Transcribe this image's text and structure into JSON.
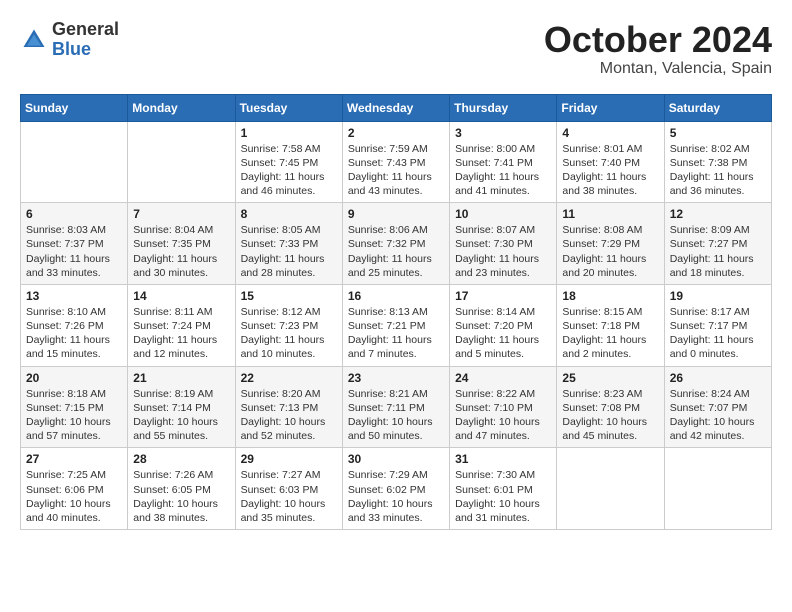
{
  "header": {
    "logo_general": "General",
    "logo_blue": "Blue",
    "month_title": "October 2024",
    "location": "Montan, Valencia, Spain"
  },
  "days_of_week": [
    "Sunday",
    "Monday",
    "Tuesday",
    "Wednesday",
    "Thursday",
    "Friday",
    "Saturday"
  ],
  "weeks": [
    [
      {
        "day": "",
        "info": ""
      },
      {
        "day": "",
        "info": ""
      },
      {
        "day": "1",
        "info": "Sunrise: 7:58 AM\nSunset: 7:45 PM\nDaylight: 11 hours and 46 minutes."
      },
      {
        "day": "2",
        "info": "Sunrise: 7:59 AM\nSunset: 7:43 PM\nDaylight: 11 hours and 43 minutes."
      },
      {
        "day": "3",
        "info": "Sunrise: 8:00 AM\nSunset: 7:41 PM\nDaylight: 11 hours and 41 minutes."
      },
      {
        "day": "4",
        "info": "Sunrise: 8:01 AM\nSunset: 7:40 PM\nDaylight: 11 hours and 38 minutes."
      },
      {
        "day": "5",
        "info": "Sunrise: 8:02 AM\nSunset: 7:38 PM\nDaylight: 11 hours and 36 minutes."
      }
    ],
    [
      {
        "day": "6",
        "info": "Sunrise: 8:03 AM\nSunset: 7:37 PM\nDaylight: 11 hours and 33 minutes."
      },
      {
        "day": "7",
        "info": "Sunrise: 8:04 AM\nSunset: 7:35 PM\nDaylight: 11 hours and 30 minutes."
      },
      {
        "day": "8",
        "info": "Sunrise: 8:05 AM\nSunset: 7:33 PM\nDaylight: 11 hours and 28 minutes."
      },
      {
        "day": "9",
        "info": "Sunrise: 8:06 AM\nSunset: 7:32 PM\nDaylight: 11 hours and 25 minutes."
      },
      {
        "day": "10",
        "info": "Sunrise: 8:07 AM\nSunset: 7:30 PM\nDaylight: 11 hours and 23 minutes."
      },
      {
        "day": "11",
        "info": "Sunrise: 8:08 AM\nSunset: 7:29 PM\nDaylight: 11 hours and 20 minutes."
      },
      {
        "day": "12",
        "info": "Sunrise: 8:09 AM\nSunset: 7:27 PM\nDaylight: 11 hours and 18 minutes."
      }
    ],
    [
      {
        "day": "13",
        "info": "Sunrise: 8:10 AM\nSunset: 7:26 PM\nDaylight: 11 hours and 15 minutes."
      },
      {
        "day": "14",
        "info": "Sunrise: 8:11 AM\nSunset: 7:24 PM\nDaylight: 11 hours and 12 minutes."
      },
      {
        "day": "15",
        "info": "Sunrise: 8:12 AM\nSunset: 7:23 PM\nDaylight: 11 hours and 10 minutes."
      },
      {
        "day": "16",
        "info": "Sunrise: 8:13 AM\nSunset: 7:21 PM\nDaylight: 11 hours and 7 minutes."
      },
      {
        "day": "17",
        "info": "Sunrise: 8:14 AM\nSunset: 7:20 PM\nDaylight: 11 hours and 5 minutes."
      },
      {
        "day": "18",
        "info": "Sunrise: 8:15 AM\nSunset: 7:18 PM\nDaylight: 11 hours and 2 minutes."
      },
      {
        "day": "19",
        "info": "Sunrise: 8:17 AM\nSunset: 7:17 PM\nDaylight: 11 hours and 0 minutes."
      }
    ],
    [
      {
        "day": "20",
        "info": "Sunrise: 8:18 AM\nSunset: 7:15 PM\nDaylight: 10 hours and 57 minutes."
      },
      {
        "day": "21",
        "info": "Sunrise: 8:19 AM\nSunset: 7:14 PM\nDaylight: 10 hours and 55 minutes."
      },
      {
        "day": "22",
        "info": "Sunrise: 8:20 AM\nSunset: 7:13 PM\nDaylight: 10 hours and 52 minutes."
      },
      {
        "day": "23",
        "info": "Sunrise: 8:21 AM\nSunset: 7:11 PM\nDaylight: 10 hours and 50 minutes."
      },
      {
        "day": "24",
        "info": "Sunrise: 8:22 AM\nSunset: 7:10 PM\nDaylight: 10 hours and 47 minutes."
      },
      {
        "day": "25",
        "info": "Sunrise: 8:23 AM\nSunset: 7:08 PM\nDaylight: 10 hours and 45 minutes."
      },
      {
        "day": "26",
        "info": "Sunrise: 8:24 AM\nSunset: 7:07 PM\nDaylight: 10 hours and 42 minutes."
      }
    ],
    [
      {
        "day": "27",
        "info": "Sunrise: 7:25 AM\nSunset: 6:06 PM\nDaylight: 10 hours and 40 minutes."
      },
      {
        "day": "28",
        "info": "Sunrise: 7:26 AM\nSunset: 6:05 PM\nDaylight: 10 hours and 38 minutes."
      },
      {
        "day": "29",
        "info": "Sunrise: 7:27 AM\nSunset: 6:03 PM\nDaylight: 10 hours and 35 minutes."
      },
      {
        "day": "30",
        "info": "Sunrise: 7:29 AM\nSunset: 6:02 PM\nDaylight: 10 hours and 33 minutes."
      },
      {
        "day": "31",
        "info": "Sunrise: 7:30 AM\nSunset: 6:01 PM\nDaylight: 10 hours and 31 minutes."
      },
      {
        "day": "",
        "info": ""
      },
      {
        "day": "",
        "info": ""
      }
    ]
  ]
}
